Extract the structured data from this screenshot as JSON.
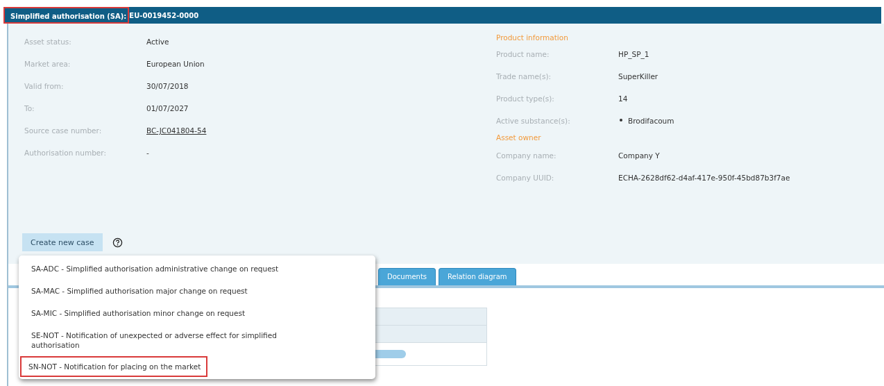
{
  "header": {
    "label": "Simplified authorisation (SA):",
    "label_highlighted": true,
    "value": "EU-0019452-0000"
  },
  "left_fields": [
    {
      "label": "Asset status:",
      "value": "Active",
      "kind": "text"
    },
    {
      "label": "Market area:",
      "value": "European Union",
      "kind": "text"
    },
    {
      "label": "Valid from:",
      "value": "30/07/2018",
      "kind": "text"
    },
    {
      "label": "To:",
      "value": "01/07/2027",
      "kind": "text"
    },
    {
      "label": "Source case number:",
      "value": "BC-JC041804-54",
      "kind": "link"
    },
    {
      "label": "Authorisation number:",
      "value": "-",
      "kind": "text"
    }
  ],
  "product_information": {
    "title": "Product information",
    "fields": [
      {
        "label": "Product name:",
        "value": "HP_SP_1",
        "kind": "text"
      },
      {
        "label": "Trade name(s):",
        "value": "SuperKiller",
        "kind": "text"
      },
      {
        "label": "Product type(s):",
        "value": "14",
        "kind": "text"
      },
      {
        "label": "Active substance(s):",
        "value": "Brodifacoum",
        "kind": "bullet"
      }
    ]
  },
  "asset_owner": {
    "title": "Asset owner",
    "fields": [
      {
        "label": "Company name:",
        "value": "Company Y",
        "kind": "text"
      },
      {
        "label": "Company UUID:",
        "value": "ECHA-2628df62-d4af-417e-950f-45bd87b3f7ae",
        "kind": "text"
      }
    ]
  },
  "create_button": {
    "label": "Create new case"
  },
  "case_menu": [
    {
      "label": "SA-ADC - Simplified authorisation administrative change on request",
      "highlighted": false
    },
    {
      "label": "SA-MAC - Simplified authorisation major change on request",
      "highlighted": false
    },
    {
      "label": "SA-MIC - Simplified authorisation minor change on request",
      "highlighted": false
    },
    {
      "label": "SE-NOT - Notification of unexpected or adverse effect for simplified authorisation",
      "highlighted": false
    },
    {
      "label": "SN-NOT - Notification for placing on the market",
      "highlighted": true
    }
  ],
  "tabs": [
    {
      "label": "Documents",
      "selected": false
    },
    {
      "label": "Relation diagram",
      "selected": false
    }
  ]
}
